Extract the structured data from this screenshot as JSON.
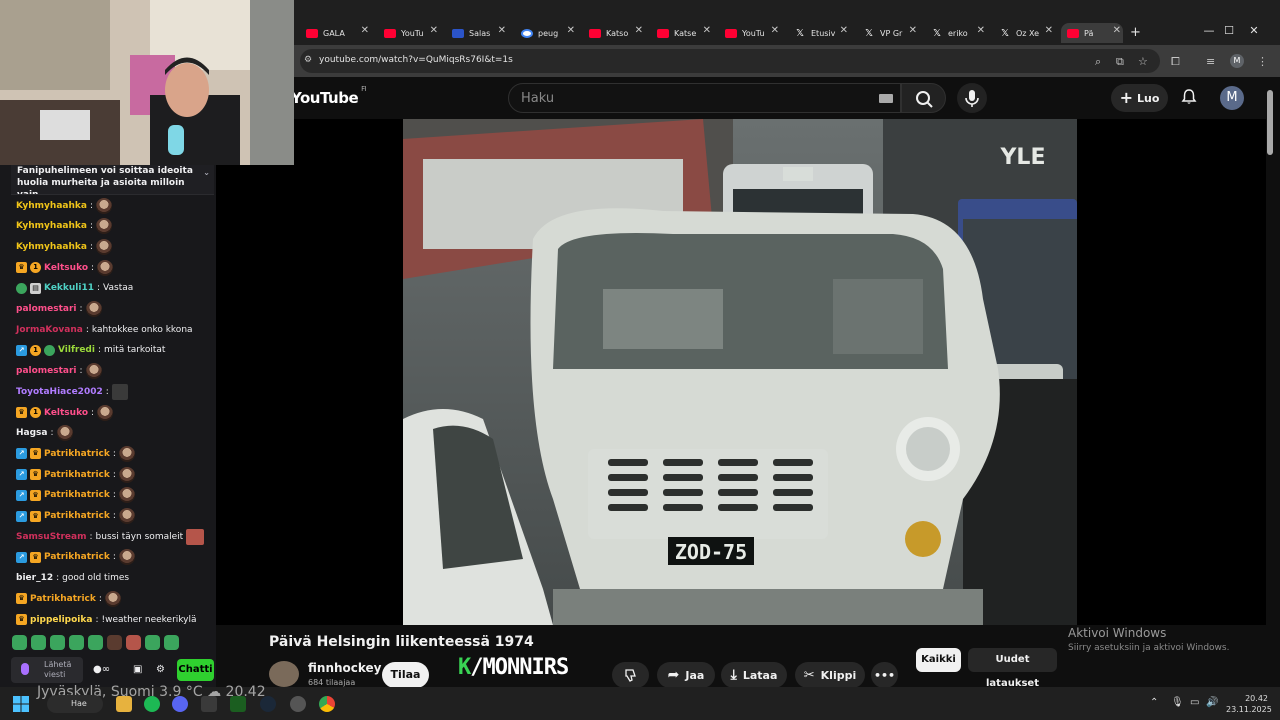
{
  "browser": {
    "tabs": [
      {
        "label": "GALA",
        "favicon": "youtube-icon"
      },
      {
        "label": "YouTu",
        "favicon": "youtube-icon"
      },
      {
        "label": "Salas",
        "favicon": "bank-icon"
      },
      {
        "label": "peug",
        "favicon": "google-icon"
      },
      {
        "label": "Katso",
        "favicon": "youtube-icon"
      },
      {
        "label": "Katse",
        "favicon": "youtube-icon"
      },
      {
        "label": "YouTu",
        "favicon": "youtube-icon"
      },
      {
        "label": "Etusiv",
        "favicon": "x-icon"
      },
      {
        "label": "VP Gr",
        "favicon": "x-icon"
      },
      {
        "label": "eriko",
        "favicon": "x-icon"
      },
      {
        "label": "Oz Xe",
        "favicon": "x-icon"
      },
      {
        "label": "Pä",
        "favicon": "youtube-icon",
        "active": true
      }
    ],
    "url": "youtube.com/watch?v=QuMiqsRs76I&t=1s",
    "profile_initial": "M"
  },
  "youtube": {
    "logo": "YouTube",
    "region": "FI",
    "search_placeholder": "Haku",
    "create_label": "Luo",
    "avatar_initial": "M",
    "video": {
      "title": "Päivä Helsingin liikenteessä 1974",
      "plate": "ZOD-75",
      "sign_text": "YLE"
    },
    "channel": {
      "name": "finnhockey",
      "subscribers": "684 tilaajaa"
    },
    "subscribe_label": "Tilaa",
    "watermark": {
      "k": "K",
      "rest": "/MONNIRS"
    },
    "actions": {
      "share": "Jaa",
      "download": "Lataa",
      "clip": "Klippi"
    },
    "chips": {
      "all": "Kaikki",
      "new": "Uudet lataukset"
    },
    "activate_title": "Aktivoi Windows",
    "activate_sub": "Siirry asetuksiin ja aktivoi Windows."
  },
  "chat": {
    "pinned_text": "Fanipuhelimeen voi soittaa ideoita huolia murheita ja asioita milloin vain...",
    "messages": [
      {
        "user": "Kyhmyhaahka",
        "color": "#f0c419",
        "badges": [],
        "text": "",
        "emote": "face"
      },
      {
        "user": "Kyhmyhaahka",
        "color": "#f0c419",
        "badges": [],
        "text": "",
        "emote": "face"
      },
      {
        "user": "Kyhmyhaahka",
        "color": "#f0c419",
        "badges": [],
        "text": "",
        "emote": "face"
      },
      {
        "user": "Keltsuko",
        "color": "#ff4f8b",
        "badges": [
          "crown",
          "one"
        ],
        "text": "",
        "emote": "face"
      },
      {
        "user": "Kekkuli11",
        "color": "#4fd1c5",
        "badges": [
          "green",
          "gift"
        ],
        "text": "Vastaa",
        "emote": ""
      },
      {
        "user": "palomestari",
        "color": "#ff4f8b",
        "badges": [],
        "text": "",
        "emote": "face"
      },
      {
        "user": "JormaKovana",
        "color": "#d0305c",
        "badges": [],
        "text": "kahtokkee onko kkona",
        "emote": ""
      },
      {
        "user": "Vilfredi",
        "color": "#9bd93b",
        "badges": [
          "sub",
          "one",
          "green"
        ],
        "text": "mitä tarkoitat",
        "emote": ""
      },
      {
        "user": "palomestari",
        "color": "#ff4f8b",
        "badges": [],
        "text": "",
        "emote": "face"
      },
      {
        "user": "ToyotaHiace2002",
        "color": "#b07cff",
        "badges": [],
        "text": "",
        "emote": "dark"
      },
      {
        "user": "Keltsuko",
        "color": "#ff4f8b",
        "badges": [
          "crown",
          "one"
        ],
        "text": "",
        "emote": "face"
      },
      {
        "user": "Hagsa",
        "color": "#efeff1",
        "badges": [],
        "text": "",
        "emote": "face"
      },
      {
        "user": "Patrikhatrick",
        "color": "#f5a623",
        "badges": [
          "sub",
          "crown"
        ],
        "text": "",
        "emote": "face"
      },
      {
        "user": "Patrikhatrick",
        "color": "#f5a623",
        "badges": [
          "sub",
          "crown"
        ],
        "text": "",
        "emote": "face"
      },
      {
        "user": "Patrikhatrick",
        "color": "#f5a623",
        "badges": [
          "sub",
          "crown"
        ],
        "text": "",
        "emote": "face"
      },
      {
        "user": "Patrikhatrick",
        "color": "#f5a623",
        "badges": [
          "sub",
          "crown"
        ],
        "text": "",
        "emote": "face"
      },
      {
        "user": "SamsuStream",
        "color": "#d0305c",
        "badges": [],
        "text": "bussi täyn somaleit",
        "emote": "red"
      },
      {
        "user": "Patrikhatrick",
        "color": "#f5a623",
        "badges": [
          "sub",
          "crown"
        ],
        "text": "",
        "emote": "face"
      },
      {
        "user": "bier_12",
        "color": "#efeff1",
        "badges": [],
        "text": "good old times",
        "emote": ""
      },
      {
        "user": "Patrikhatrick",
        "color": "#f5a623",
        "badges": [
          "crown"
        ],
        "text": "",
        "emote": "face"
      },
      {
        "user": "pippelipoika",
        "color": "#ffd84d",
        "badges": [
          "crown"
        ],
        "text": "!weather neekerikylä",
        "emote": ""
      }
    ],
    "send_label": "Lähetä viesti",
    "chat_button": "Chatti"
  },
  "taskbar": {
    "weather": "Jyväskylä, Suomi   3.9 °C",
    "weather_time": "20.42",
    "search_label": "Hae",
    "time": "20.42",
    "date": "23.11.2025"
  }
}
